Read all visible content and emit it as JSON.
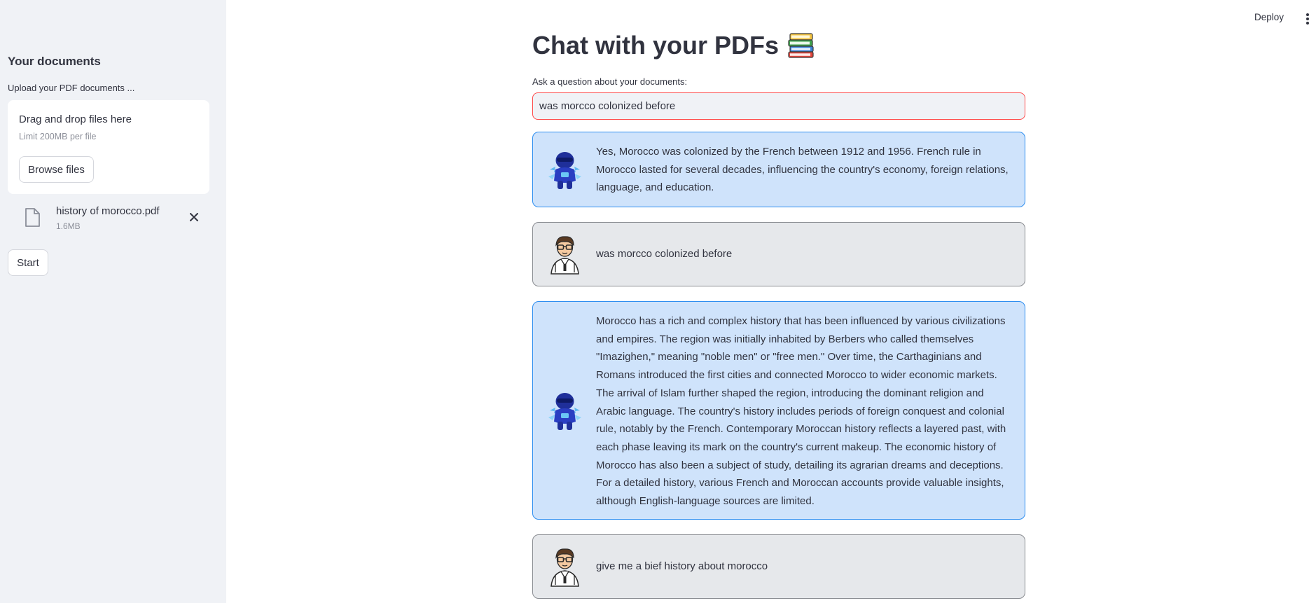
{
  "sidebar": {
    "title": "Your documents",
    "upload_label": "Upload your PDF documents ...",
    "dropzone": {
      "title": "Drag and drop files here",
      "limit": "Limit 200MB per file",
      "browse_label": "Browse files"
    },
    "file": {
      "name": "history of morocco.pdf",
      "size": "1.6MB"
    },
    "start_label": "Start"
  },
  "header": {
    "deploy_label": "Deploy"
  },
  "main": {
    "title": "Chat with your PDFs",
    "question_label": "Ask a question about your documents:",
    "question_value": "was morcco colonized before",
    "messages": [
      {
        "role": "bot",
        "text": "Yes, Morocco was colonized by the French between 1912 and 1956. French rule in Morocco lasted for several decades, influencing the country's economy, foreign relations, language, and education."
      },
      {
        "role": "user",
        "text": "was morcco colonized before"
      },
      {
        "role": "bot",
        "text": "Morocco has a rich and complex history that has been influenced by various civilizations and empires. The region was initially inhabited by Berbers who called themselves \"Imazighen,\" meaning \"noble men\" or \"free men.\" Over time, the Carthaginians and Romans introduced the first cities and connected Morocco to wider economic markets. The arrival of Islam further shaped the region, introducing the dominant religion and Arabic language. The country's history includes periods of foreign conquest and colonial rule, notably by the French. Contemporary Moroccan history reflects a layered past, with each phase leaving its mark on the country's current makeup. The economic history of Morocco has also been a subject of study, detailing its agrarian dreams and deceptions. For a detailed history, various French and Moroccan accounts provide valuable insights, although English-language sources are limited."
      },
      {
        "role": "user",
        "text": "give me a bief history about morocco"
      }
    ]
  },
  "colors": {
    "accent_red": "#ff4b4b",
    "bot_bubble_bg": "#cfe3fb",
    "bot_bubble_border": "#2e8ef0",
    "user_bubble_bg": "#e6e8eb",
    "sidebar_bg": "#f0f2f6"
  },
  "icons": {
    "file": "file-icon",
    "remove": "close-icon",
    "title_emoji": "books-icon",
    "bot_avatar": "robot-avatar-icon",
    "user_avatar": "person-avatar-icon",
    "menu": "kebab-menu-icon"
  }
}
